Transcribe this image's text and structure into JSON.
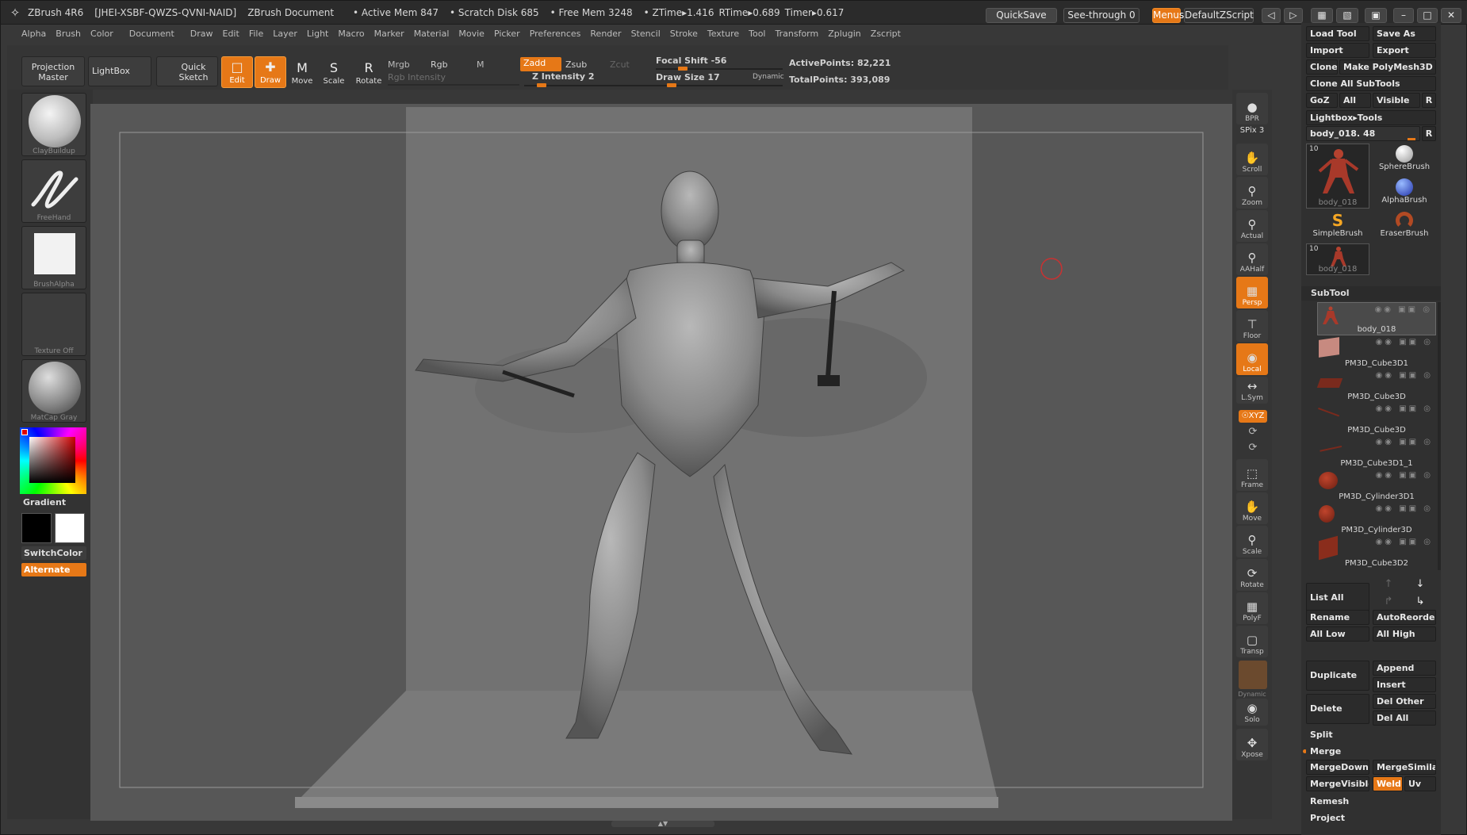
{
  "titlebar": {
    "app": "ZBrush 4R6",
    "serial": "[JHEI-XSBF-QWZS-QVNI-NAID]",
    "document": "ZBrush Document",
    "active_mem": "• Active Mem 847",
    "scratch": "• Scratch Disk 685",
    "free_mem": "• Free Mem 3248",
    "ztime": "• ZTime▸1.416",
    "rtime": "RTime▸0.689",
    "timer": "Timer▸0.617",
    "quicksave": "QuickSave",
    "seethrough": "See-through  0",
    "menus": "Menus",
    "script": "DefaultZScript"
  },
  "menubar": [
    "Alpha",
    "Brush",
    "Color",
    "Document",
    "Draw",
    "Edit",
    "File",
    "Layer",
    "Light",
    "Macro",
    "Marker",
    "Material",
    "Movie",
    "Picker",
    "Preferences",
    "Render",
    "Stencil",
    "Stroke",
    "Texture",
    "Tool",
    "Transform",
    "Zplugin",
    "Zscript"
  ],
  "shelf": {
    "projection_master": "Projection Master",
    "lightbox": "LightBox",
    "quick_sketch": "Quick Sketch",
    "edit": "Edit",
    "draw": "Draw",
    "move": "Move",
    "scale": "Scale",
    "rotate": "Rotate",
    "mrgb": "Mrgb",
    "rgb": "Rgb",
    "m": "M",
    "zadd": "Zadd",
    "zsub": "Zsub",
    "zcut": "Zcut",
    "rgb_intensity": "Rgb Intensity",
    "z_intensity": "Z Intensity 2",
    "focal_shift": "Focal Shift -56",
    "draw_size": "Draw Size 17",
    "dynamic": "Dynamic",
    "active_points": "ActivePoints: 82,221",
    "total_points": "TotalPoints: 393,089"
  },
  "left_tray": {
    "brush": "ClayBuildup",
    "stroke": "FreeHand",
    "alpha": "BrushAlpha",
    "texture": "Texture Off",
    "material": "MatCap Gray",
    "gradient": "Gradient",
    "switchcolor": "SwitchColor",
    "alternate": "Alternate"
  },
  "right_rail": {
    "bpr": "BPR",
    "spix": "SPix 3",
    "scroll": "Scroll",
    "zoom": "Zoom",
    "actual": "Actual",
    "aahalf": "AAHalf",
    "persp": "Persp",
    "floor": "Floor",
    "local": "Local",
    "lsym": "L.Sym",
    "xyz": "☉XYZ",
    "frame": "Frame",
    "move": "Move",
    "scale": "Scale",
    "rotate": "Rotate",
    "polyf": "PolyF",
    "transp": "Transp",
    "dynamic": "Dynamic",
    "solo": "Solo",
    "xpose": "Xpose"
  },
  "tool_panel": {
    "load_tool": "Load Tool",
    "save_as": "Save As",
    "import": "Import",
    "export": "Export",
    "clone": "Clone",
    "make_polymesh": "Make PolyMesh3D",
    "clone_all": "Clone  All  SubTools",
    "goz": "GoZ",
    "all": "All",
    "visible": "Visible",
    "r": "R",
    "lightbox_tools": "Lightbox▸Tools",
    "current_tool": "body_018. 48",
    "thumbs": [
      {
        "name": "body_018",
        "count": "10"
      },
      {
        "name": "SphereBrush"
      },
      {
        "name": "AlphaBrush"
      },
      {
        "name": "SimpleBrush"
      },
      {
        "name": "EraserBrush"
      },
      {
        "name": "body_018",
        "count": "10"
      }
    ]
  },
  "subtool": {
    "header": "SubTool",
    "items": [
      "body_018",
      "PM3D_Cube3D1",
      "PM3D_Cube3D",
      "PM3D_Cube3D",
      "PM3D_Cube3D1_1",
      "PM3D_Cylinder3D1",
      "PM3D_Cylinder3D",
      "PM3D_Cube3D2"
    ],
    "list_all": "List  All",
    "rename": "Rename",
    "autoreorder": "AutoReorder",
    "all_low": "All Low",
    "all_high": "All High",
    "duplicate": "Duplicate",
    "append": "Append",
    "insert": "Insert",
    "delete": "Delete",
    "del_other": "Del Other",
    "del_all": "Del All",
    "split": "Split",
    "merge": "Merge",
    "mergedown": "MergeDown",
    "mergesimilar": "MergeSimilar",
    "mergevisible": "MergeVisible",
    "weld": "Weld",
    "uv": "Uv",
    "remesh": "Remesh",
    "project": "Project"
  },
  "colors": {
    "accent": "#e67817",
    "panel": "#303030",
    "canvas": "#575757"
  }
}
